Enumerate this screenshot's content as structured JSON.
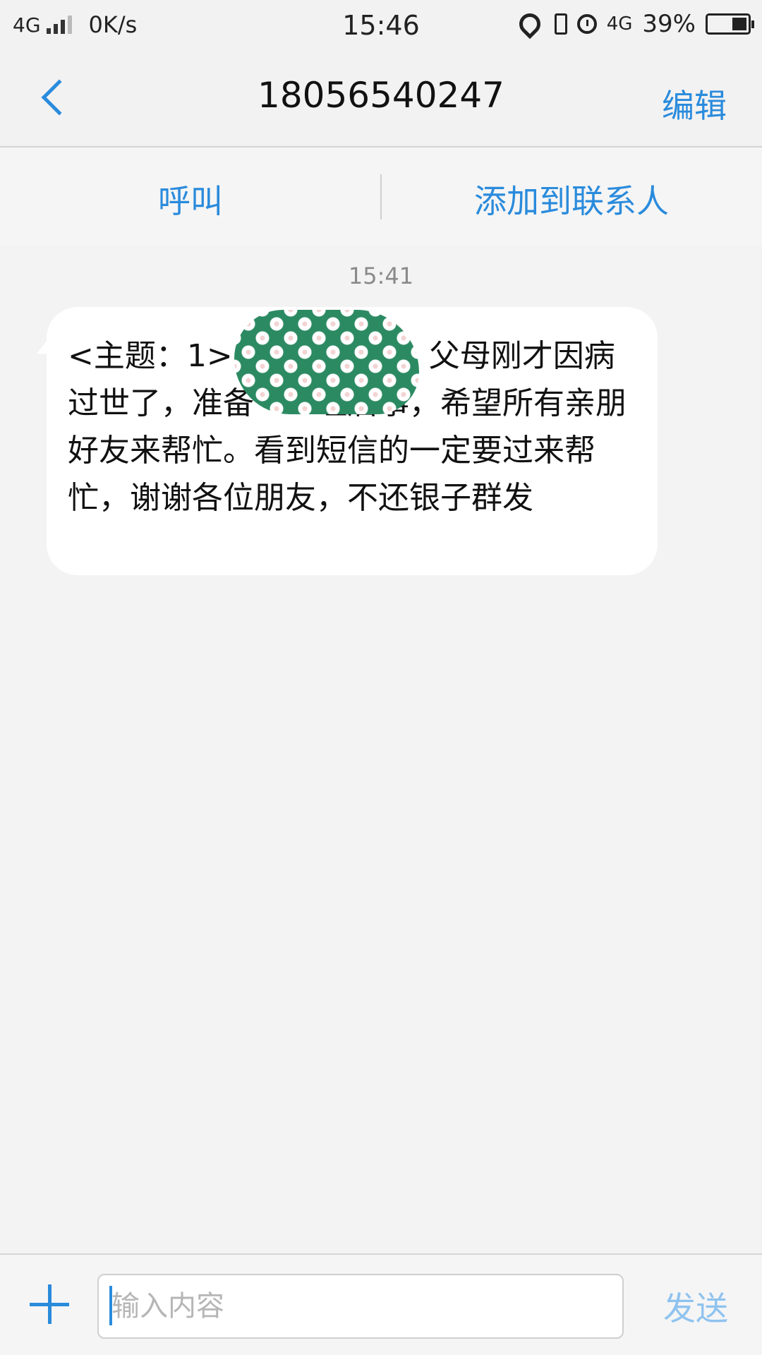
{
  "status_bar": {
    "network": "4G",
    "speed": "0K/s",
    "time": "15:46",
    "network_right": "4G",
    "battery_percent": "39%",
    "battery_level": 0.39
  },
  "header": {
    "title": "18056540247",
    "edit_label": "编辑",
    "back_icon": "chevron-left-icon"
  },
  "actions": {
    "call_label": "呼叫",
    "add_contact_label": "添加到联系人"
  },
  "conversation": {
    "timestamp": "15:41",
    "messages": [
      {
        "direction": "incoming",
        "text": "<主题：1> 　　　　　　父母刚才因病过世了，准备　　理后事，希望所有亲朋好友来帮忙。看到短信的一定要过来帮忙，谢谢各位朋友，不还银子群发",
        "redacted": true
      }
    ]
  },
  "composer": {
    "placeholder": "输入内容",
    "value": "",
    "send_label": "发送",
    "add_icon": "plus-icon"
  },
  "colors": {
    "accent": "#2a8bdc",
    "send_disabled": "#8fc3ef",
    "background": "#f3f3f3",
    "bubble": "#ffffff",
    "redaction": "#2c8a62"
  }
}
